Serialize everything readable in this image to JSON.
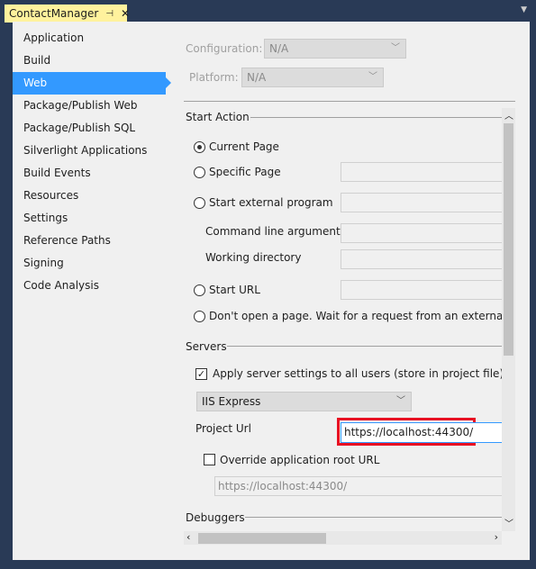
{
  "tab": {
    "title": "ContactManager",
    "pin_icon": "pin-icon",
    "close_icon": "close-icon"
  },
  "nav": [
    "Application",
    "Build",
    "Web",
    "Package/Publish Web",
    "Package/Publish SQL",
    "Silverlight Applications",
    "Build Events",
    "Resources",
    "Settings",
    "Reference Paths",
    "Signing",
    "Code Analysis"
  ],
  "nav_selected": "Web",
  "config": {
    "label": "Configuration:",
    "value": "N/A"
  },
  "platform": {
    "label": "Platform:",
    "value": "N/A"
  },
  "start_action": {
    "header": "Start Action",
    "current_page": "Current Page",
    "specific_page": "Specific Page",
    "external_program": "Start external program",
    "cmd_args": "Command line arguments",
    "working_dir": "Working directory",
    "start_url": "Start URL",
    "dont_open": "Don't open a page.  Wait for a request from an external applic",
    "selected": "Current Page"
  },
  "servers": {
    "header": "Servers",
    "apply_all": "Apply server settings to all users (store in project file)",
    "apply_all_checked": true,
    "server": "IIS Express",
    "project_url_label": "Project Url",
    "project_url": "https://localhost:44300/",
    "override": "Override application root URL",
    "override_checked": false,
    "override_url": "https://localhost:44300/"
  },
  "debuggers": {
    "header": "Debuggers"
  },
  "colors": {
    "selection": "#3399ff",
    "tab": "#fff29d",
    "highlight": "#e81123"
  }
}
